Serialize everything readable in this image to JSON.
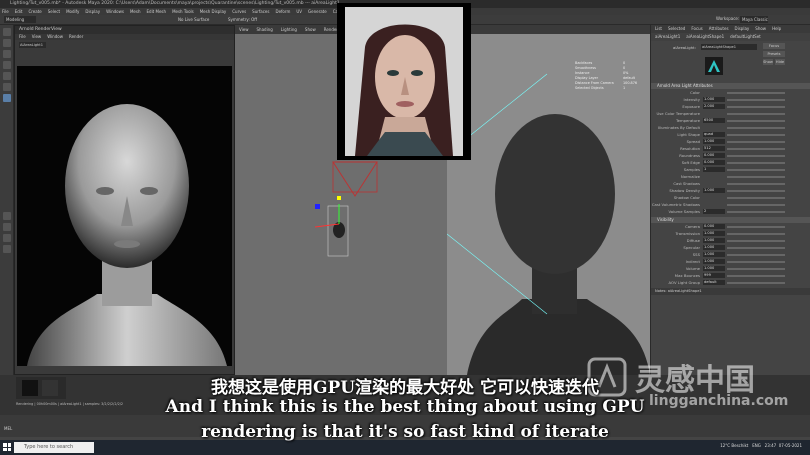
{
  "window": {
    "title": "Lighting/Tut_v005.mb* - Autodesk Maya 2020: C:\\Users\\Adam\\Documents\\maya\\projects\\Quarantine\\scenes\\Lighting/Tut_v005.mb --- aiAreaLight1",
    "workspace": "Maya Classic",
    "workspace_label": "Workspace:"
  },
  "menubar": [
    "File",
    "Edit",
    "Create",
    "Select",
    "Modify",
    "Display",
    "Windows",
    "Mesh",
    "Edit Mesh",
    "Mesh Tools",
    "Mesh Display",
    "Curves",
    "Surfaces",
    "Deform",
    "UV",
    "Generate",
    "Cache",
    "Arnold",
    "Help"
  ],
  "status": {
    "mode": "Modeling",
    "no_live": "No Live Surface",
    "symmetry": "Symmetry: Off"
  },
  "render_view": {
    "title": "Arnold RenderView",
    "menu": [
      "File",
      "View",
      "Window",
      "Render"
    ],
    "selector": "AiAreaLight1"
  },
  "viewport": {
    "panels": [
      "View",
      "Shading",
      "Lighting",
      "Show",
      "Renderer",
      "Panels"
    ],
    "tabs": [
      "Arnold",
      "Attribute Editor",
      "Channel Box",
      "Outliner"
    ]
  },
  "attribute_editor": {
    "tabs": [
      "List",
      "Selected",
      "Focus",
      "Attributes",
      "Display",
      "Show",
      "Help"
    ],
    "node_tabs": [
      "aiAreaLight1",
      "aiAreaLightShape1",
      "defaultLightSet"
    ],
    "node_label": "aiAreaLight:",
    "node_value": "aiAreaLightShape1",
    "buttons": [
      "Focus",
      "Presets",
      "Show",
      "Hide"
    ],
    "section_main": "Arnold Area Light Attributes",
    "rows": [
      {
        "label": "Color",
        "value": ""
      },
      {
        "label": "Intensity",
        "value": "1.000"
      },
      {
        "label": "Exposure",
        "value": "2.000"
      },
      {
        "label": "Use Color Temperature",
        "value": ""
      },
      {
        "label": "Temperature",
        "value": "6500"
      },
      {
        "label": "Illuminates By Default",
        "value": ""
      },
      {
        "label": "Light Shape",
        "value": "quad"
      },
      {
        "label": "Spread",
        "value": "1.000"
      },
      {
        "label": "Resolution",
        "value": "512"
      },
      {
        "label": "Roundness",
        "value": "0.000"
      },
      {
        "label": "Soft Edge",
        "value": "0.000"
      },
      {
        "label": "Samples",
        "value": "1"
      },
      {
        "label": "Normalize",
        "value": ""
      },
      {
        "label": "Cast Shadows",
        "value": ""
      },
      {
        "label": "Shadow Density",
        "value": "1.000"
      },
      {
        "label": "Shadow Color",
        "value": ""
      },
      {
        "label": "Cast Volumetric Shadows",
        "value": ""
      },
      {
        "label": "Volume Samples",
        "value": "2"
      }
    ],
    "section_visibility": "Visibility",
    "vis_rows": [
      {
        "label": "Camera",
        "value": "0.000"
      },
      {
        "label": "Transmission",
        "value": "1.000"
      },
      {
        "label": "Diffuse",
        "value": "1.000"
      },
      {
        "label": "Specular",
        "value": "1.000"
      },
      {
        "label": "SSS",
        "value": "1.000"
      },
      {
        "label": "Indirect",
        "value": "1.000"
      },
      {
        "label": "Volume",
        "value": "1.000"
      },
      {
        "label": "Max Bounces",
        "value": "999"
      },
      {
        "label": "AOV Light Group",
        "value": "default"
      }
    ],
    "notes_label": "Notes: aiAreaLightShape1"
  },
  "viewport_hud": {
    "rows": [
      "Backfaces",
      "Smoothness",
      "Instance",
      "Display Layer",
      "Distance From Camera",
      "Selected Objects"
    ],
    "values": [
      "0",
      "0",
      "0%",
      "default",
      "100.876",
      "1"
    ]
  },
  "command_line": {
    "lang": "MEL",
    "help": "Rendering | 00h00m00s | aiAreaLight1 | samples: 3/2/2/2/2/2/2"
  },
  "taskbar": {
    "search_placeholder": "Type here to search",
    "weather": "12°C Beschikt",
    "lang": "ENG",
    "time": "23:47",
    "date": "07-05-2021"
  },
  "subtitles": {
    "cn": "我想这是使用GPU渲染的最大好处 它可以快速迭代",
    "en1": "And I think this is the best thing about using GPU",
    "en2": "rendering is that it's so fast kind of iterate"
  },
  "watermark": {
    "brand": "灵感中国",
    "url": "lingganchina.com"
  }
}
